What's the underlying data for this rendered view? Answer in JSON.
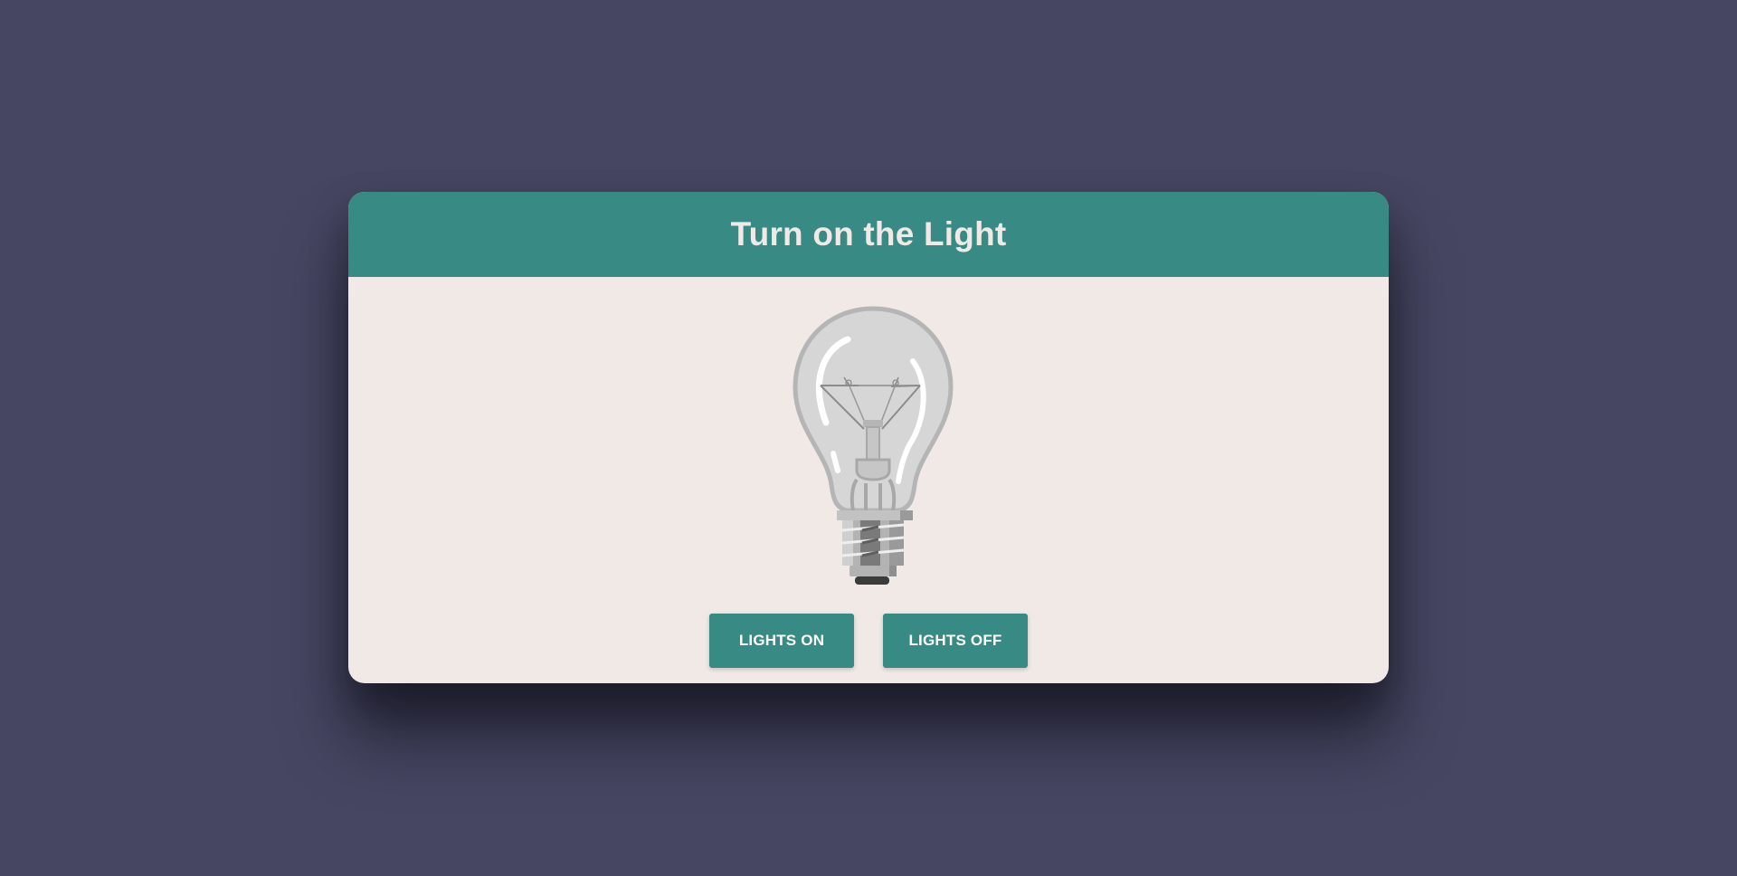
{
  "app": {
    "title": "Turn on the Light"
  },
  "controls": {
    "on_label": "LIGHTS ON",
    "off_label": "LIGHTS OFF"
  },
  "state": {
    "light": "off"
  },
  "icons": {
    "bulb": "lightbulb-icon"
  },
  "colors": {
    "background": "#464662",
    "card": "#f1e9e6",
    "accent": "#378b84",
    "title_text": "#f1e9e6",
    "button_text": "#ffffff"
  }
}
